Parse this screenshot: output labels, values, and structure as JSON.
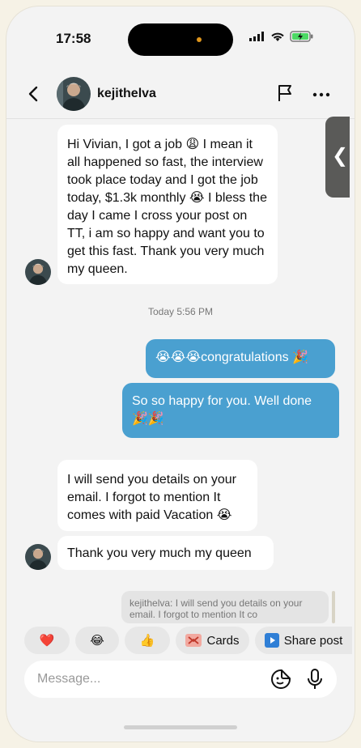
{
  "status_bar": {
    "time": "17:58"
  },
  "header": {
    "username": "kejithelva"
  },
  "messages": {
    "m1": "Hi Vivian, I got a job 😩 I mean it all happened so fast, the interview took place today and I got the job today, $1.3k monthly 😭 I bless the day I came I cross your post on TT, i am so happy and want you to get this fast. Thank you very much my queen.",
    "timestamp": "Today 5:56 PM",
    "m2": "😭😭😭congratulations 🎉",
    "m3": "So so happy for you. Well done 🎉🎉",
    "m4": "I will send you details on your email. I forgot to mention It comes with paid Vacation 😭",
    "m5": "Thank you very much my queen"
  },
  "reply_preview": "kejithelva: I will send you details on your email. I forgot to mention It co",
  "quick_replies": {
    "heart": "❤️",
    "laugh": "😂",
    "thumbs": "👍",
    "cards": "Cards",
    "share_post": "Share post"
  },
  "composer": {
    "placeholder": "Message..."
  },
  "colors": {
    "outgoing_bubble": "#4aa0d0",
    "incoming_bubble": "#ffffff",
    "background": "#f3f3f3"
  }
}
